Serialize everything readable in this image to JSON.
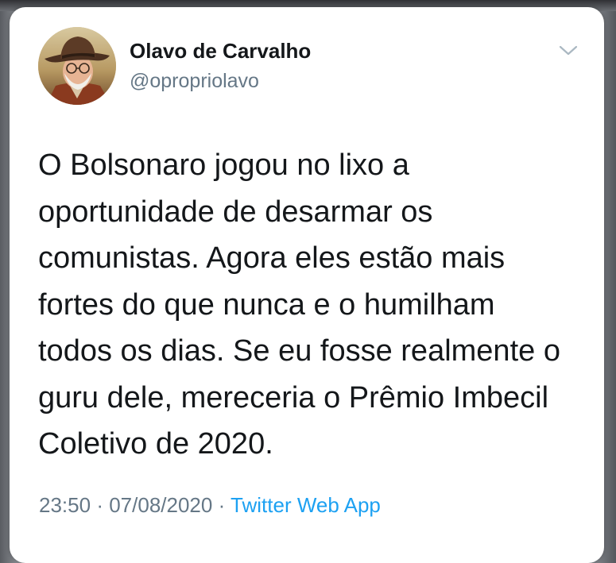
{
  "tweet": {
    "author": {
      "display_name": "Olavo de Carvalho",
      "handle": "@opropriolavo",
      "avatar_icon": "profile-photo-man-in-cowboy-hat"
    },
    "menu_icon": "chevron-down-icon",
    "text_lines": [
      "O Bolsonaro jogou no lixo a",
      "oportunidade de desarmar os",
      "comunistas. Agora eles estão mais",
      "fortes do que nunca e o humilham",
      "todos os dias. Se eu fosse realmente o",
      "guru dele, mereceria o Prêmio Imbecil",
      "Coletivo de 2020."
    ],
    "time": "23:50",
    "separator": "·",
    "date": "07/08/2020",
    "source": "Twitter Web App"
  },
  "colors": {
    "text_primary": "#14171a",
    "text_secondary": "#657786",
    "link": "#1da1f2",
    "card_background": "#ffffff"
  }
}
